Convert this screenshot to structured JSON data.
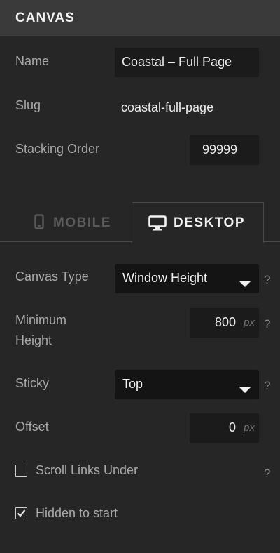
{
  "panel": {
    "title": "CANVAS"
  },
  "fields": {
    "name_label": "Name",
    "name_value": "Coastal – Full Page",
    "slug_label": "Slug",
    "slug_value": "coastal-full-page",
    "stacking_label": "Stacking Order",
    "stacking_value": "99999"
  },
  "tabs": [
    {
      "label": "MOBILE",
      "icon": "mobile-phone-icon",
      "active": false
    },
    {
      "label": "DESKTOP",
      "icon": "desktop-monitor-icon",
      "active": true
    }
  ],
  "settings": {
    "canvas_type_label": "Canvas Type",
    "canvas_type_value": "Window Height",
    "min_height_label_1": "Minimum",
    "min_height_label_2": "Height",
    "min_height_value": "800",
    "min_height_unit": "px",
    "sticky_label": "Sticky",
    "sticky_value": "Top",
    "offset_label": "Offset",
    "offset_value": "0",
    "offset_unit": "px",
    "scroll_links_label": "Scroll Links Under",
    "scroll_links_checked": false,
    "hidden_label": "Hidden to start",
    "hidden_checked": true,
    "help_glyph": "?"
  }
}
